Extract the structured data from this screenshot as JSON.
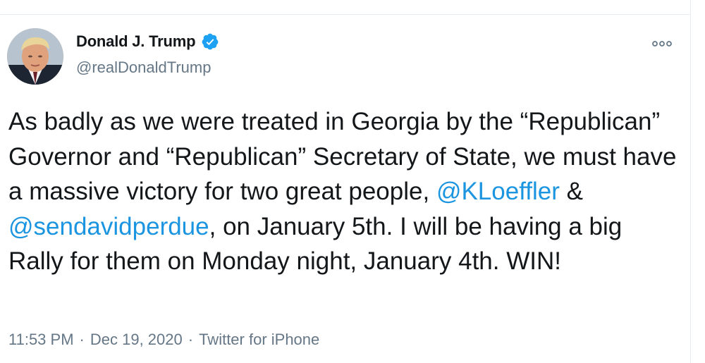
{
  "tweet": {
    "author": {
      "display_name": "Donald J. Trump",
      "handle": "@realDonaldTrump",
      "verified": true
    },
    "text": {
      "part1": "As badly as we were treated in Georgia by the “Republican” Governor and “Republican” Secretary of State, we must have a massive victory for two great people, ",
      "mention1": "@KLoeffler",
      "part2": " & ",
      "mention2": "@sendavidperdue",
      "part3": ", on January 5th. I will be having a big Rally for them on Monday night, January 4th. WIN!"
    },
    "meta": {
      "time": "11:53 PM",
      "separator1": "·",
      "date": "Dec 19, 2020",
      "separator2": "·",
      "source": "Twitter for iPhone"
    },
    "icons": {
      "verified": "verified-badge-icon",
      "more": "more-options-icon"
    }
  },
  "colors": {
    "text": "#14171a",
    "secondary": "#657786",
    "link": "#1b95e0",
    "verified": "#1da1f2",
    "border": "#e6ecf0"
  }
}
